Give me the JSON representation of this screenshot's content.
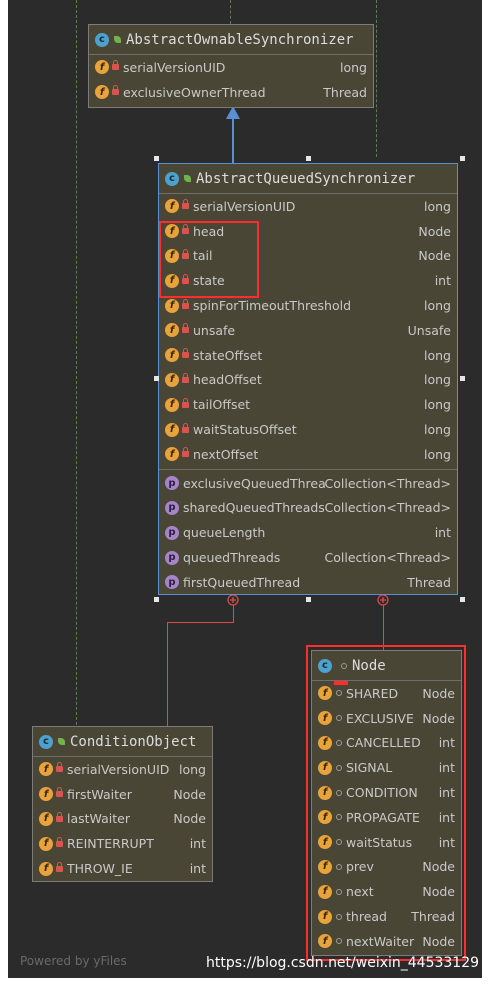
{
  "classes": {
    "aos": {
      "title": "AbstractOwnableSynchronizer",
      "fields": [
        {
          "name": "serialVersionUID",
          "type": "long"
        },
        {
          "name": "exclusiveOwnerThread",
          "type": "Thread"
        }
      ]
    },
    "aqs": {
      "title": "AbstractQueuedSynchronizer",
      "fields": [
        {
          "name": "serialVersionUID",
          "type": "long"
        },
        {
          "name": "head",
          "type": "Node"
        },
        {
          "name": "tail",
          "type": "Node"
        },
        {
          "name": "state",
          "type": "int"
        },
        {
          "name": "spinForTimeoutThreshold",
          "type": "long"
        },
        {
          "name": "unsafe",
          "type": "Unsafe"
        },
        {
          "name": "stateOffset",
          "type": "long"
        },
        {
          "name": "headOffset",
          "type": "long"
        },
        {
          "name": "tailOffset",
          "type": "long"
        },
        {
          "name": "waitStatusOffset",
          "type": "long"
        },
        {
          "name": "nextOffset",
          "type": "long"
        }
      ],
      "properties": [
        {
          "name": "exclusiveQueuedThreads",
          "type": "Collection<Thread>"
        },
        {
          "name": "sharedQueuedThreads",
          "type": "Collection<Thread>"
        },
        {
          "name": "queueLength",
          "type": "int"
        },
        {
          "name": "queuedThreads",
          "type": "Collection<Thread>"
        },
        {
          "name": "firstQueuedThread",
          "type": "Thread"
        }
      ]
    },
    "condition": {
      "title": "ConditionObject",
      "fields": [
        {
          "name": "serialVersionUID",
          "type": "long"
        },
        {
          "name": "firstWaiter",
          "type": "Node"
        },
        {
          "name": "lastWaiter",
          "type": "Node"
        },
        {
          "name": "REINTERRUPT",
          "type": "int"
        },
        {
          "name": "THROW_IE",
          "type": "int"
        }
      ]
    },
    "node": {
      "title": "Node",
      "fields": [
        {
          "name": "SHARED",
          "type": "Node"
        },
        {
          "name": "EXCLUSIVE",
          "type": "Node"
        },
        {
          "name": "CANCELLED",
          "type": "int"
        },
        {
          "name": "SIGNAL",
          "type": "int"
        },
        {
          "name": "CONDITION",
          "type": "int"
        },
        {
          "name": "PROPAGATE",
          "type": "int"
        },
        {
          "name": "waitStatus",
          "type": "int"
        },
        {
          "name": "prev",
          "type": "Node"
        },
        {
          "name": "next",
          "type": "Node"
        },
        {
          "name": "thread",
          "type": "Thread"
        },
        {
          "name": "nextWaiter",
          "type": "Node"
        }
      ]
    }
  },
  "footer": "Powered by yFiles",
  "watermark": "https://blog.csdn.net/weixin_44533129",
  "colors": {
    "background": "#2b2b2b",
    "classFill": "#4a4636",
    "highlight": "#ff2d2d",
    "inheritArrow": "#5a8fd4",
    "innerLink": "#d94a4a"
  }
}
